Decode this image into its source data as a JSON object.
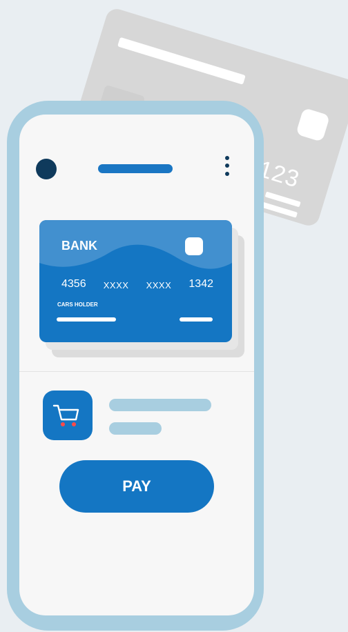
{
  "background_card": {
    "number_fragment": "123"
  },
  "card": {
    "bank_name": "BANK",
    "number": [
      "4356",
      "XXXX",
      "XXXX",
      "1342"
    ],
    "holder_label": "CARS HOLDER"
  },
  "actions": {
    "pay_label": "PAY"
  },
  "icons": {
    "cart": "shopping-cart-icon",
    "menu": "vertical-dots-menu-icon"
  },
  "colors": {
    "primary": "#1476c3",
    "phone_frame": "#a8cee0",
    "camera": "#0f3a5c",
    "background": "#e9eef2"
  }
}
